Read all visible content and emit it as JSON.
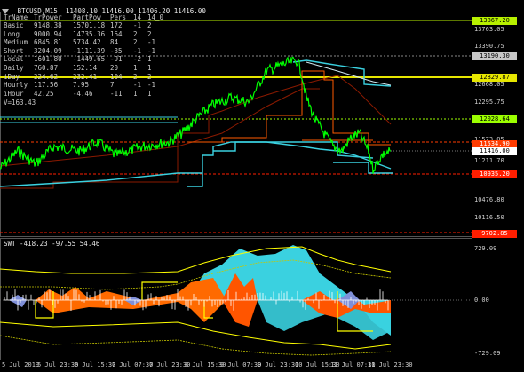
{
  "header": {
    "symbol_icon": "triangle-down-icon",
    "title": "BTCUSD,M15  11408.10 11416.00 11406.20 11416.00"
  },
  "table": {
    "columns": [
      "TrName",
      "TrPower",
      "PartPow",
      "Pers",
      "14",
      "14_0"
    ],
    "rows": [
      [
        "Basic",
        "9148.38",
        "15701.18",
        "172",
        "-1",
        "2"
      ],
      [
        "Long",
        "9000.94",
        "14735.36",
        "164",
        "2",
        "2"
      ],
      [
        "Medium",
        "6845.81",
        "5734.42",
        "84",
        "2",
        "-1"
      ],
      [
        "Short",
        "3204.09",
        "-1111.39",
        "-35",
        "-1",
        "-1"
      ],
      [
        "Local",
        "1601.80",
        "-1449.65",
        "-91",
        "-2",
        "1"
      ],
      [
        "Daily",
        "760.87",
        "152.14",
        "20",
        "1",
        "1"
      ],
      [
        "iDay",
        "224.62",
        "232.41",
        "104",
        "2",
        "2"
      ],
      [
        "Hourly",
        "117.56",
        "7.95",
        "7",
        "-1",
        "-1"
      ],
      [
        "iHour",
        "42.25",
        "-4.46",
        "-11",
        "1",
        "1"
      ]
    ],
    "footer": "V=163.43"
  },
  "price_axis": {
    "labels": [
      "13763.05",
      "13390.75",
      "12668.05",
      "12295.75",
      "11573.05",
      "11211.70",
      "10839.40",
      "10476.80",
      "10116.50",
      "9744.20"
    ],
    "tags": [
      {
        "text": "13867.20",
        "bg": "#b7f000",
        "fg": "#000000"
      },
      {
        "text": "13190.30",
        "bg": "#c8c8c8",
        "fg": "#000000"
      },
      {
        "text": "12829.87",
        "bg": "#e6e600",
        "fg": "#000000"
      },
      {
        "text": "12028.64",
        "bg": "#9cff00",
        "fg": "#000000"
      },
      {
        "text": "11534.90",
        "bg": "#ff3b00",
        "fg": "#ffffff"
      },
      {
        "text": "11416.00",
        "bg": "#ffffff",
        "fg": "#000000"
      },
      {
        "text": "10935.20",
        "bg": "#ff1e00",
        "fg": "#ffffff"
      },
      {
        "text": "9702.85",
        "bg": "#ff1e00",
        "fg": "#ffffff"
      }
    ]
  },
  "indicator": {
    "title": "SWT -418.23 -97.55 54.46",
    "axis_labels": [
      "729.09",
      "0.00",
      "-729.09"
    ]
  },
  "time_axis": [
    "5 Jul 2019",
    "5 Jul 23:30",
    "6 Jul 15:30",
    "7 Jul 07:30",
    "7 Jul 23:30",
    "8 Jul 15:30",
    "9 Jul 07:30",
    "9 Jul 23:30",
    "10 Jul 15:30",
    "11 Jul 07:30",
    "11 Jul 23:30"
  ],
  "colors": {
    "background": "#000000",
    "price": "#00ff00",
    "teal": "#3ad1e0",
    "dark_red": "#8b1a00",
    "orange": "#ff5a00",
    "yellow": "#ffff00"
  }
}
